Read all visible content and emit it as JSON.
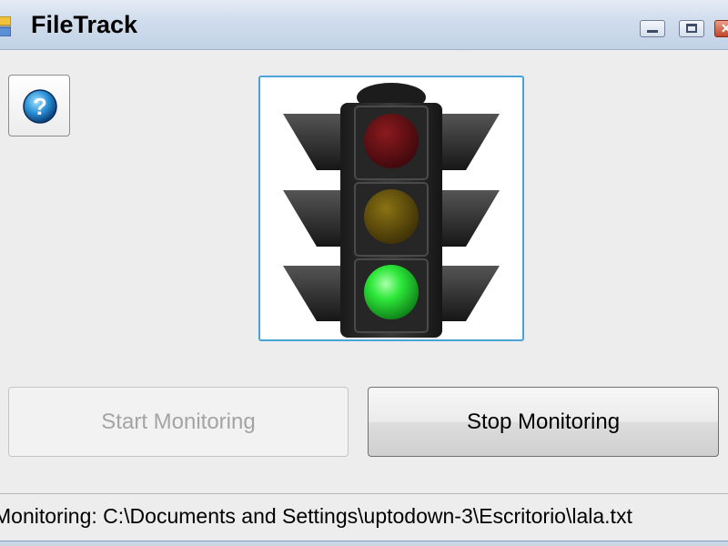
{
  "window": {
    "title": "FileTrack",
    "controls": {
      "minimize": "minimize",
      "maximize": "maximize",
      "close": "close"
    }
  },
  "toolbar": {
    "help_icon": "help-question-icon"
  },
  "status_light": {
    "icon": "traffic-light-icon",
    "state": "green",
    "colors": {
      "red_off": "#5a0f12",
      "yellow_off": "#5c4a0c",
      "green_on": "#1fd12e"
    }
  },
  "buttons": {
    "start_label": "Start Monitoring",
    "start_enabled": false,
    "stop_label": "Stop Monitoring",
    "stop_enabled": true
  },
  "statusbar": {
    "text": "Monitoring: C:\\Documents and Settings\\uptodown-3\\Escritorio\\lala.txt"
  },
  "colors": {
    "title_gradient_top": "#e4ebf5",
    "focus_border": "#4aa3d6"
  }
}
